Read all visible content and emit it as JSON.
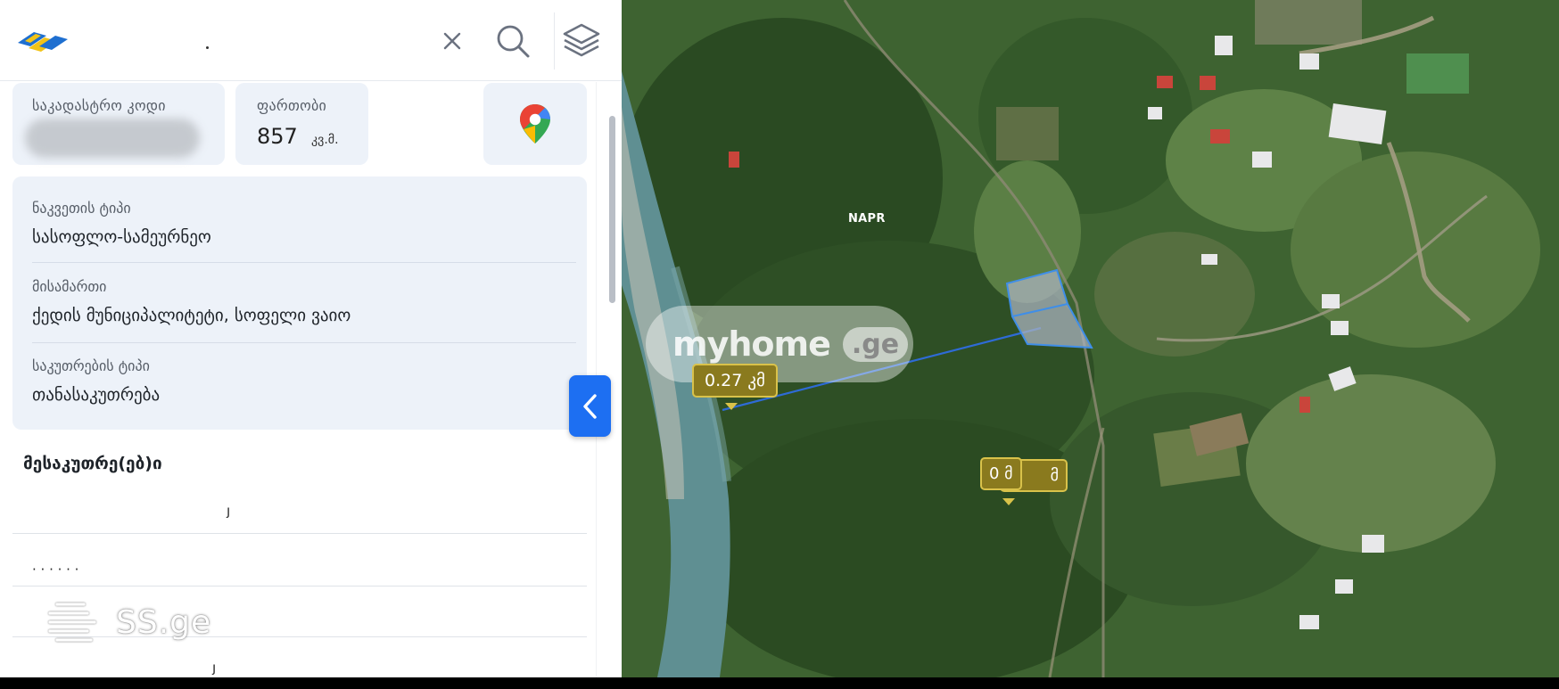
{
  "header": {
    "close_icon": "close-icon",
    "search_icon": "search-icon",
    "layers_icon": "layers-icon"
  },
  "summary": {
    "cadastral_code_label": "საკადასტრო კოდი",
    "area_label": "ფართობი",
    "area_value": "857",
    "area_unit": "კვ.მ.",
    "map_icon": "google-maps-pin-icon"
  },
  "details": {
    "parcel_type_label": "ნაკვეთის ტიპი",
    "parcel_type_value": "სასოფლო-სამეურნეო",
    "address_label": "მისამართი",
    "address_value": "ქედის მუნიციპალიტეტი, სოფელი ვაიო",
    "ownership_type_label": "საკუთრების ტიპი",
    "ownership_type_value": "თანასაკუთრება"
  },
  "owners": {
    "title": "მესაკუთრე(ებ)ი",
    "row1_fragment": "ȷ",
    "row2_fragment": "· ·  ·  ·  · ·",
    "row4_fragment": "ȷ"
  },
  "watermarks": {
    "ssge": "SS.ge",
    "myhome_main": "myhome",
    "myhome_tld": ".ge",
    "napr": "NAPR"
  },
  "map": {
    "distance_label": "0.27 კმ",
    "marker_label_a": "0 მ",
    "marker_label_b": "მ",
    "collapse_icon": "chevron-left-icon"
  },
  "colors": {
    "accent": "#1d6ff2",
    "card_bg": "#edf2f9",
    "measure_line": "#2e6bd6",
    "parcel_fill": "#a9b2bd",
    "tag_bg": "#8a7a1e"
  }
}
